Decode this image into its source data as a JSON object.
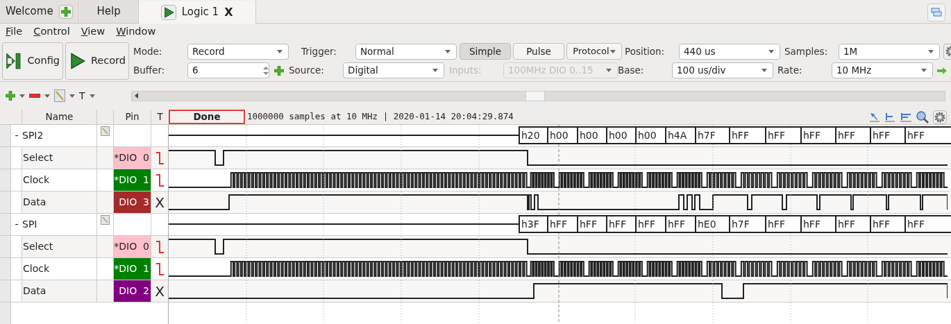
{
  "tabs": [
    {
      "label": "Welcome",
      "selected": false
    },
    {
      "label": "Help",
      "selected": false
    },
    {
      "label": "Logic 1",
      "selected": true,
      "close": "X"
    }
  ],
  "menu": [
    "File",
    "Control",
    "View",
    "Window"
  ],
  "toolbar": {
    "config": "Config",
    "record": "Record",
    "rows": [
      [
        {
          "label": "Mode:",
          "value": "Record",
          "kind": "combo"
        },
        {
          "label": "Trigger:",
          "value": "Normal",
          "kind": "combo"
        },
        {
          "kind": "buttons",
          "buttons": [
            {
              "label": "Simple",
              "selected": true
            },
            {
              "label": "Pulse",
              "selected": false
            },
            {
              "label": "Protocol",
              "selected": false
            }
          ]
        },
        {
          "label": "Position:",
          "value": "440 us",
          "kind": "combo"
        },
        {
          "label": "Samples:",
          "value": "1M",
          "kind": "combo"
        }
      ],
      [
        {
          "label": "Buffer:",
          "value": "6",
          "kind": "spin"
        },
        {
          "label": "Source:",
          "value": "Digital",
          "kind": "combo"
        },
        {
          "label": "Inputs:",
          "value": "100MHz DIO 0..15",
          "kind": "combo",
          "disabled": true
        },
        {
          "label": "Base:",
          "value": "100 us/div",
          "kind": "combo"
        },
        {
          "label": "Rate:",
          "value": "10 MHz",
          "kind": "combo"
        }
      ]
    ]
  },
  "signal_tools": [
    "T"
  ],
  "columns": [
    "Name",
    "Pin",
    "T"
  ],
  "status": {
    "badge": "Done",
    "text": "1000000 samples at 10 MHz | 2020-01-14 20:04:29.874"
  },
  "groups": [
    {
      "toggle": "-",
      "name": "SPI2",
      "bus": [
        "h20",
        "h00",
        "h00",
        "h00",
        "h00",
        "h4A",
        "h7F",
        "hFF",
        "hFF",
        "hFF",
        "hFF",
        "hFF",
        "hFF"
      ],
      "children": [
        {
          "name": "Select",
          "pin": "*DIO  0",
          "color": "#ffc0cb",
          "falling_edge": true
        },
        {
          "name": "Clock",
          "pin": "*DIO  1",
          "color": "#008000",
          "falling_edge": true
        },
        {
          "name": "Data",
          "pin": "DIO  3",
          "color": "#a52a2a",
          "falling_edge": false,
          "trigger_text": "X"
        }
      ]
    },
    {
      "toggle": "-",
      "name": "SPI",
      "bus": [
        "h3F",
        "hFF",
        "hFF",
        "hFF",
        "hFF",
        "hFF",
        "hE0",
        "h7F",
        "hFF",
        "hFF",
        "hFF",
        "hFF",
        "hFF"
      ],
      "children": [
        {
          "name": "Select",
          "pin": "*DIO  0",
          "color": "#ffc0cb",
          "falling_edge": true
        },
        {
          "name": "Clock",
          "pin": "*DIO  1",
          "color": "#008000",
          "falling_edge": true
        },
        {
          "name": "Data",
          "pin": "DIO  2",
          "color": "#800080",
          "falling_edge": false,
          "trigger_text": "X"
        }
      ]
    }
  ]
}
